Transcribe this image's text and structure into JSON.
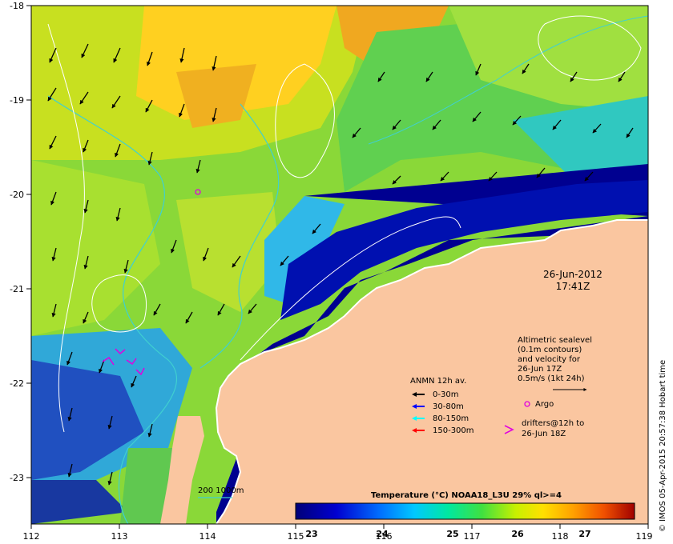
{
  "map": {
    "lon_ticks": [
      "112",
      "113",
      "114",
      "115",
      "116",
      "117",
      "118",
      "119"
    ],
    "lat_ticks": [
      "-18",
      "-19",
      "-20",
      "-21",
      "-22",
      "-23"
    ],
    "lon_range": [
      112,
      119
    ],
    "lat_range": [
      -23.5,
      -18
    ],
    "date": "26-Jun-2012",
    "time": "17:41Z",
    "altimetry_text": [
      "Altimetric sealevel",
      "(0.1m contours)",
      "and velocity for",
      "26-Jun 17Z",
      "0.5m/s (1kt 24h)"
    ],
    "argo_label": "Argo",
    "anmn_title": "ANMN 12h av.",
    "anmn_legend": [
      {
        "label": "0-30m",
        "color": "#000000"
      },
      {
        "label": "30-80m",
        "color": "#0000ff"
      },
      {
        "label": "80-150m",
        "color": "#00ffff"
      },
      {
        "label": "150-300m",
        "color": "#ff0000"
      }
    ],
    "drifters_text": [
      "drifters@12h to",
      "26-Jun 18Z"
    ],
    "bathy_label": "200  1000m",
    "colorbar_title": "Temperature (°C) NOAA18_L3U 29% ql>=4",
    "colorbar_ticks": [
      "23",
      "24",
      "25",
      "26",
      "27"
    ],
    "colorbar_range": [
      22.6,
      27.4
    ],
    "credit": "© IMOS 05-Apr-2015 20:57:38 Hobart time",
    "colors": {
      "land": "#fac6a0",
      "isobath": "#40d0d0",
      "sealevel_contour": "#ffffff",
      "argo": "#e000e0",
      "drifter": "#e000e0"
    }
  }
}
